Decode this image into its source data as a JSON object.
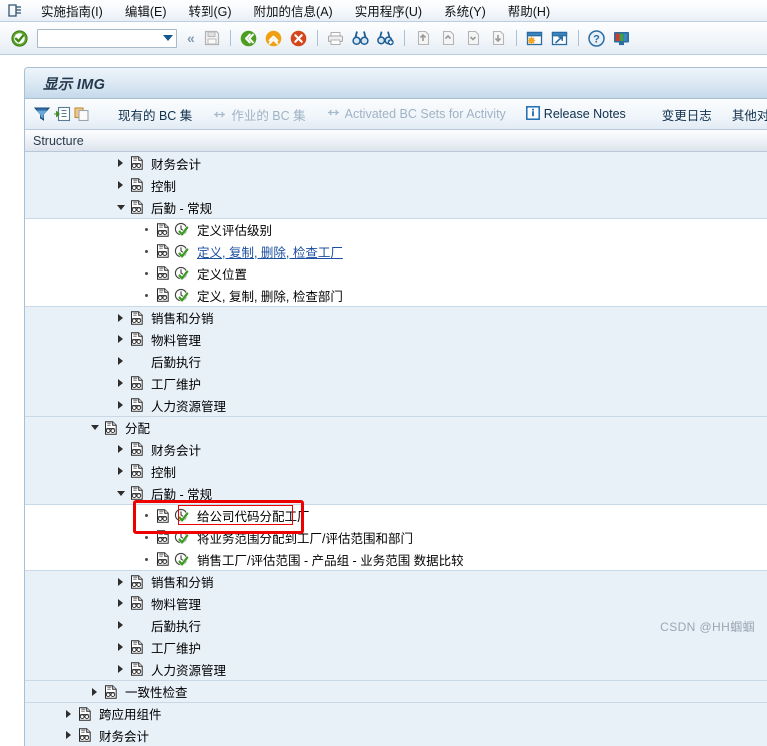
{
  "window": {
    "system_icon": "window-list-icon"
  },
  "menubar": {
    "items": [
      {
        "text": "实施指南(I)",
        "accel": "I"
      },
      {
        "text": "编辑(E)",
        "accel": "E"
      },
      {
        "text": "转到(G)",
        "accel": "G"
      },
      {
        "text": "附加的信息(A)",
        "accel": "A"
      },
      {
        "text": "实用程序(U)",
        "accel": "U"
      },
      {
        "text": "系统(Y)",
        "accel": "Y"
      },
      {
        "text": "帮助(H)",
        "accel": "H"
      }
    ]
  },
  "toolbar": {
    "enter_icon": "green-check-enter-icon",
    "command_field_value": "",
    "command_field_placeholder": "",
    "dropdown_icon": "chevron-down-icon",
    "collapse_icon": "double-chevron-left-icon",
    "icons": [
      {
        "name": "save-icon",
        "disabled": true
      },
      {
        "name": "back-green-icon",
        "disabled": false
      },
      {
        "name": "exit-yellow-icon",
        "disabled": false
      },
      {
        "name": "cancel-red-icon",
        "disabled": false
      },
      {
        "name": "print-icon",
        "disabled": true
      },
      {
        "name": "find-icon",
        "disabled": false
      },
      {
        "name": "find-next-icon",
        "disabled": false
      },
      {
        "name": "first-page-icon",
        "disabled": true
      },
      {
        "name": "previous-page-icon",
        "disabled": true
      },
      {
        "name": "next-page-icon",
        "disabled": true
      },
      {
        "name": "last-page-icon",
        "disabled": true
      },
      {
        "name": "create-session-icon",
        "disabled": false
      },
      {
        "name": "create-shortcut-icon",
        "disabled": false
      },
      {
        "name": "help-icon",
        "disabled": false
      },
      {
        "name": "customize-local-layout-icon",
        "disabled": false
      }
    ]
  },
  "panel": {
    "title": "显示 IMG",
    "toolbar": {
      "buttons": [
        {
          "name": "filter-icon",
          "label": ""
        },
        {
          "name": "expand-node-icon",
          "label": ""
        },
        {
          "name": "copy-icon",
          "label": ""
        }
      ],
      "existing_bc_sets": "现有的 BC 集",
      "active_bc_sets": "作业的 BC 集",
      "activated_bc_sets_for_activity": "Activated BC Sets for Activity",
      "release_notes": "Release Notes",
      "change_log": "变更日志",
      "other_object_owner": "其他对象所"
    }
  },
  "tree": {
    "header": "Structure",
    "rows": [
      {
        "level": 1,
        "twisty": "right",
        "doc": true,
        "activity": false,
        "label": "财务会计",
        "link": false,
        "band": true,
        "sep_top": false
      },
      {
        "level": 1,
        "twisty": "right",
        "doc": true,
        "activity": false,
        "label": "控制",
        "link": false,
        "band": true,
        "sep_top": false
      },
      {
        "level": 1,
        "twisty": "down",
        "doc": true,
        "activity": false,
        "label": "后勤 - 常规",
        "link": false,
        "band": true,
        "sep_top": false
      },
      {
        "level": 2,
        "twisty": "bullet",
        "doc": true,
        "activity": true,
        "label": "定义评估级别",
        "link": false,
        "band": false,
        "sep_top": true
      },
      {
        "level": 2,
        "twisty": "bullet",
        "doc": true,
        "activity": true,
        "label": "定义, 复制, 删除, 检查工厂",
        "link": true,
        "band": false,
        "sep_top": false
      },
      {
        "level": 2,
        "twisty": "bullet",
        "doc": true,
        "activity": true,
        "label": "定义位置",
        "link": false,
        "band": false,
        "sep_top": false
      },
      {
        "level": 2,
        "twisty": "bullet",
        "doc": true,
        "activity": true,
        "label": "定义, 复制, 删除, 检查部门",
        "link": false,
        "band": false,
        "sep_top": false
      },
      {
        "level": 1,
        "twisty": "right",
        "doc": true,
        "activity": false,
        "label": "销售和分销",
        "link": false,
        "band": true,
        "sep_top": true
      },
      {
        "level": 1,
        "twisty": "right",
        "doc": true,
        "activity": false,
        "label": "物料管理",
        "link": false,
        "band": true,
        "sep_top": false
      },
      {
        "level": 1,
        "twisty": "right",
        "doc": false,
        "activity": false,
        "label": "后勤执行",
        "link": false,
        "band": true,
        "sep_top": false
      },
      {
        "level": 1,
        "twisty": "right",
        "doc": true,
        "activity": false,
        "label": "工厂维护",
        "link": false,
        "band": true,
        "sep_top": false
      },
      {
        "level": 1,
        "twisty": "right",
        "doc": true,
        "activity": false,
        "label": "人力资源管理",
        "link": false,
        "band": true,
        "sep_top": false
      },
      {
        "level": 0,
        "twisty": "down",
        "doc": true,
        "activity": false,
        "label": "分配",
        "link": false,
        "band": true,
        "sep_top": true
      },
      {
        "level": 1,
        "twisty": "right",
        "doc": true,
        "activity": false,
        "label": "财务会计",
        "link": false,
        "band": true,
        "sep_top": false
      },
      {
        "level": 1,
        "twisty": "right",
        "doc": true,
        "activity": false,
        "label": "控制",
        "link": false,
        "band": true,
        "sep_top": false
      },
      {
        "level": 1,
        "twisty": "down",
        "doc": true,
        "activity": false,
        "label": "后勤 - 常规",
        "link": false,
        "band": true,
        "sep_top": false
      },
      {
        "level": 2,
        "twisty": "bullet",
        "doc": true,
        "activity": true,
        "label": "给公司代码分配工厂",
        "link": false,
        "band": false,
        "sep_top": true
      },
      {
        "level": 2,
        "twisty": "bullet",
        "doc": true,
        "activity": true,
        "label": "将业务范围分配到工厂/评估范围和部门",
        "link": false,
        "band": false,
        "sep_top": false
      },
      {
        "level": 2,
        "twisty": "bullet",
        "doc": true,
        "activity": true,
        "label": "销售工厂/评估范围 - 产品组 - 业务范围 数据比较",
        "link": false,
        "band": false,
        "sep_top": false
      },
      {
        "level": 1,
        "twisty": "right",
        "doc": true,
        "activity": false,
        "label": "销售和分销",
        "link": false,
        "band": true,
        "sep_top": true
      },
      {
        "level": 1,
        "twisty": "right",
        "doc": true,
        "activity": false,
        "label": "物料管理",
        "link": false,
        "band": true,
        "sep_top": false
      },
      {
        "level": 1,
        "twisty": "right",
        "doc": false,
        "activity": false,
        "label": "后勤执行",
        "link": false,
        "band": true,
        "sep_top": false
      },
      {
        "level": 1,
        "twisty": "right",
        "doc": true,
        "activity": false,
        "label": "工厂维护",
        "link": false,
        "band": true,
        "sep_top": false
      },
      {
        "level": 1,
        "twisty": "right",
        "doc": true,
        "activity": false,
        "label": "人力资源管理",
        "link": false,
        "band": true,
        "sep_top": false
      },
      {
        "level": 0,
        "twisty": "right",
        "doc": true,
        "activity": false,
        "label": "一致性检查",
        "link": false,
        "band": true,
        "sep_top": true
      },
      {
        "level": -1,
        "twisty": "right",
        "doc": true,
        "activity": false,
        "label": "跨应用组件",
        "link": false,
        "band": true,
        "sep_top": true
      },
      {
        "level": -1,
        "twisty": "right",
        "doc": true,
        "activity": false,
        "label": "财务会计",
        "link": false,
        "band": true,
        "sep_top": false
      }
    ],
    "highlighted_row_index": 16
  },
  "annotation": {
    "color": "#ee0000",
    "target_label": "给公司代码分配工厂"
  },
  "watermark": {
    "text": "CSDN @HH蝈蝈"
  }
}
